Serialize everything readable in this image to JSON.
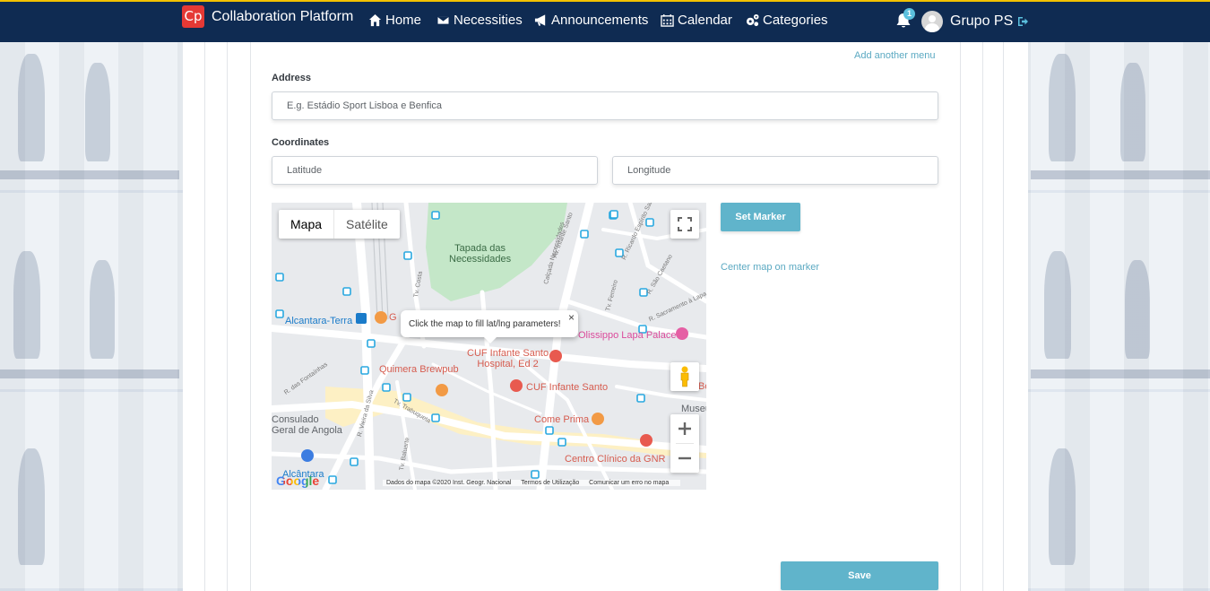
{
  "nav": {
    "brand_logo": "Cp",
    "brand_name": "Collaboration Platform",
    "items": [
      {
        "label": "Home",
        "icon": "home-icon"
      },
      {
        "label": "Necessities",
        "icon": "envelope-icon"
      },
      {
        "label": "Announcements",
        "icon": "bullhorn-icon"
      },
      {
        "label": "Calendar",
        "icon": "calendar-icon"
      },
      {
        "label": "Categories",
        "icon": "cogs-icon"
      }
    ],
    "notification_count": "1",
    "user_name": "Grupo PS",
    "accent_color": "#0f2b52"
  },
  "form": {
    "add_menu_link": "Add another menu",
    "address_label": "Address",
    "address_placeholder": "E.g. Estádio Sport Lisboa e Benfica",
    "coordinates_label": "Coordinates",
    "latitude_placeholder": "Latitude",
    "longitude_placeholder": "Longitude",
    "set_marker_label": "Set Marker",
    "center_map_label": "Center map on marker",
    "save_label": "Save"
  },
  "map": {
    "type_map": "Mapa",
    "type_satellite": "Satélite",
    "info_text": "Click the map to fill lat/lng parameters!",
    "info_close": "×",
    "labels": {
      "tapada": "Tapada das\nNecessidades",
      "alcantara_terra": "Alcantara-Terra",
      "olissippo": "Olissippo Lapa Palace",
      "quimera": "Quimera Brewpub",
      "cuf_hospital": "CUF Infante Santo\nHospital, Ed 2",
      "cuf": "CUF Infante Santo",
      "come_prima": "Come Prima",
      "consulado": "Consulado\nGeral de Angola",
      "centro_clinico": "Centro Clínico da GNR",
      "alcantara": "Alcântara",
      "museu": "Museu",
      "g_partial": "G",
      "bo_partial": "Bo",
      "av_infante_santo": "Av. Infante Santo",
      "calcada": "Calçada Necessidades",
      "r_ricardo": "R. Ricardo Espírito Santo",
      "r_sao_caetano": "R. São Caetano",
      "tv_sacramento": "R. Sacramento à Lapa",
      "tv_possidonio": "Tv. Costa",
      "tv_ferreiro": "Tv. Ferreiro",
      "r_fontainhas": "R. das Fontaínhas",
      "r_vieira_silva": "R. Vieira da Silva",
      "tv_trabuqueta": "Tv. Trabuqueta",
      "tv_baluarte": "Tv. Baluarte"
    },
    "google": "Google",
    "attribution": [
      "Dados do mapa ©2020 Inst. Geogr. Nacional",
      "Termos de Utilização",
      "Comunicar um erro no mapa"
    ],
    "colors": {
      "park": "#c4e7c8",
      "road": "#ffffff",
      "highlight": "#fdf0c4",
      "base": "#e8eaed"
    }
  }
}
